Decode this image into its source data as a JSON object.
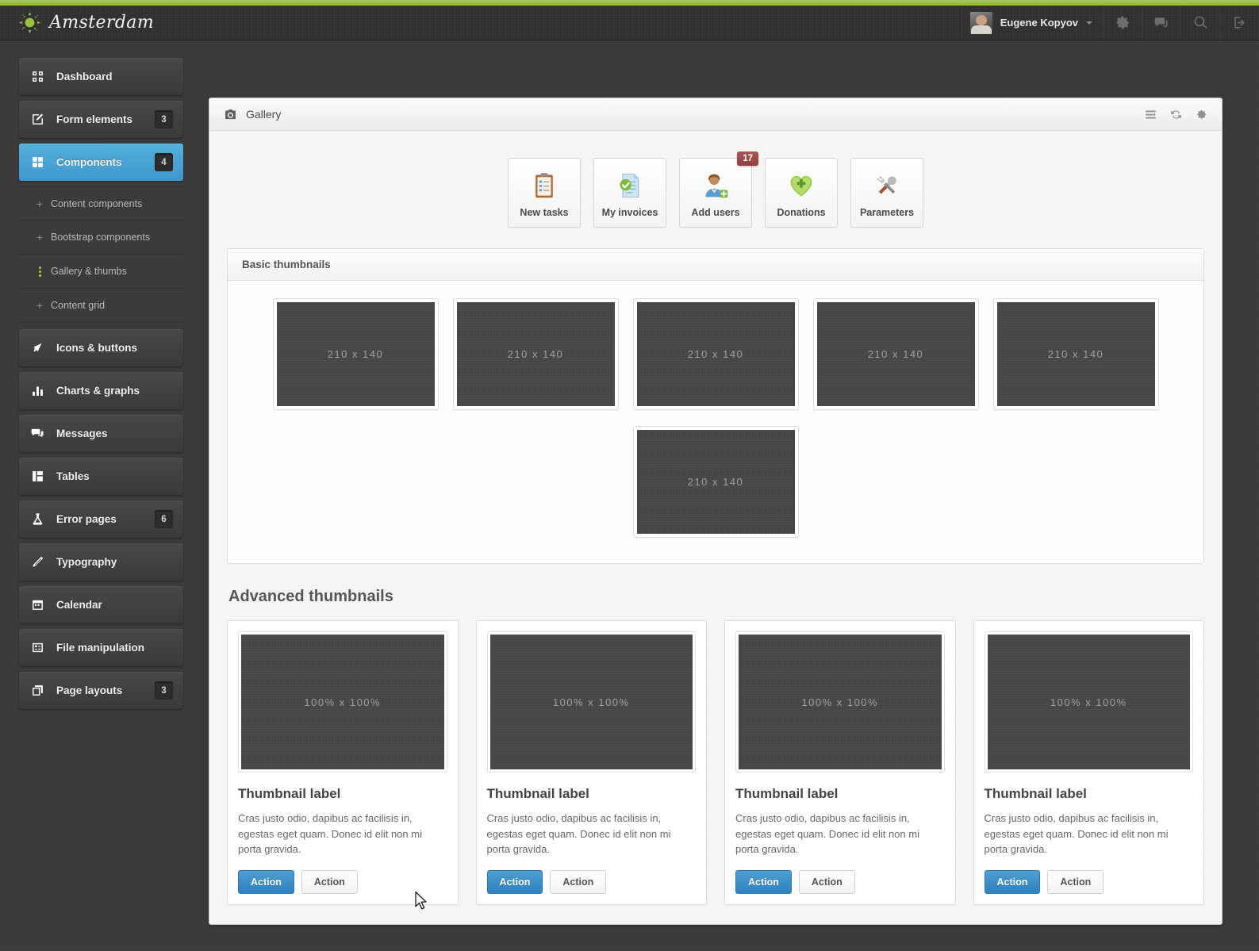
{
  "brand": {
    "name": "Amsterdam",
    "logo_icon": "sun-icon",
    "accent_green": "#9ac23c"
  },
  "header": {
    "user_name": "Eugene Kopyov",
    "avatar_icon": "user-avatar",
    "caret_icon": "chevron-down-icon",
    "icons": [
      {
        "name": "gear-icon"
      },
      {
        "name": "chat-icon"
      },
      {
        "name": "search-icon"
      },
      {
        "name": "logout-icon"
      }
    ]
  },
  "sidebar": {
    "items": [
      {
        "label": "Dashboard",
        "icon": "grid-icon",
        "badge": "",
        "active": false
      },
      {
        "label": "Form elements",
        "icon": "edit-square-icon",
        "badge": "3",
        "active": false
      },
      {
        "label": "Components",
        "icon": "blocks-icon",
        "badge": "4",
        "active": true
      },
      {
        "label": "Icons & buttons",
        "icon": "cursor-arrow-icon",
        "badge": "",
        "active": false
      },
      {
        "label": "Charts & graphs",
        "icon": "bar-chart-icon",
        "badge": "",
        "active": false
      },
      {
        "label": "Messages",
        "icon": "chat-bubbles-icon",
        "badge": "",
        "active": false
      },
      {
        "label": "Tables",
        "icon": "table-icon",
        "badge": "",
        "active": false
      },
      {
        "label": "Error pages",
        "icon": "flask-icon",
        "badge": "6",
        "active": false
      },
      {
        "label": "Typography",
        "icon": "pen-icon",
        "badge": "",
        "active": false
      },
      {
        "label": "Calendar",
        "icon": "calendar-icon",
        "badge": "",
        "active": false
      },
      {
        "label": "File manipulation",
        "icon": "file-box-icon",
        "badge": "",
        "active": false
      },
      {
        "label": "Page layouts",
        "icon": "layers-icon",
        "badge": "3",
        "active": false
      }
    ],
    "submenu": [
      {
        "label": "Content components",
        "marker": "plus",
        "active": false
      },
      {
        "label": "Bootstrap components",
        "marker": "plus",
        "active": false
      },
      {
        "label": "Gallery & thumbs",
        "marker": "dots",
        "active": true
      },
      {
        "label": "Content grid",
        "marker": "plus",
        "active": false
      }
    ]
  },
  "panel": {
    "title": "Gallery",
    "head_icon": "camera-icon",
    "tools": [
      {
        "name": "collapse-icon"
      },
      {
        "name": "refresh-icon"
      },
      {
        "name": "settings-gear-icon"
      }
    ]
  },
  "tiles": [
    {
      "label": "New tasks",
      "icon": "clipboard-icon",
      "badge": ""
    },
    {
      "label": "My invoices",
      "icon": "document-check-icon",
      "badge": ""
    },
    {
      "label": "Add users",
      "icon": "add-user-icon",
      "badge": "17"
    },
    {
      "label": "Donations",
      "icon": "heart-plus-icon",
      "badge": ""
    },
    {
      "label": "Parameters",
      "icon": "tools-icon",
      "badge": ""
    }
  ],
  "basic_thumbnails": {
    "title": "Basic thumbnails",
    "items": [
      {
        "caption": "210 x 140"
      },
      {
        "caption": "210 x 140"
      },
      {
        "caption": "210 x 140"
      },
      {
        "caption": "210 x 140"
      },
      {
        "caption": "210 x 140"
      },
      {
        "caption": "210 x 140"
      }
    ]
  },
  "advanced_thumbnails": {
    "title": "Advanced thumbnails",
    "cards": [
      {
        "image_caption": "100% x 100%",
        "title": "Thumbnail label",
        "text": "Cras justo odio, dapibus ac facilisis in, egestas eget quam. Donec id elit non mi porta gravida.",
        "primary_action": "Action",
        "secondary_action": "Action"
      },
      {
        "image_caption": "100% x 100%",
        "title": "Thumbnail label",
        "text": "Cras justo odio, dapibus ac facilisis in, egestas eget quam. Donec id elit non mi porta gravida.",
        "primary_action": "Action",
        "secondary_action": "Action"
      },
      {
        "image_caption": "100% x 100%",
        "title": "Thumbnail label",
        "text": "Cras justo odio, dapibus ac facilisis in, egestas eget quam. Donec id elit non mi porta gravida.",
        "primary_action": "Action",
        "secondary_action": "Action"
      },
      {
        "image_caption": "100% x 100%",
        "title": "Thumbnail label",
        "text": "Cras justo odio, dapibus ac facilisis in, egestas eget quam. Donec id elit non mi porta gravida.",
        "primary_action": "Action",
        "secondary_action": "Action"
      }
    ]
  },
  "colors": {
    "accent_green": "#9ac23c",
    "active_blue": "#4ba3d3",
    "primary_button": "#2f80bd",
    "badge_red": "#9d4a4a",
    "placeholder_gray": "#464646"
  }
}
